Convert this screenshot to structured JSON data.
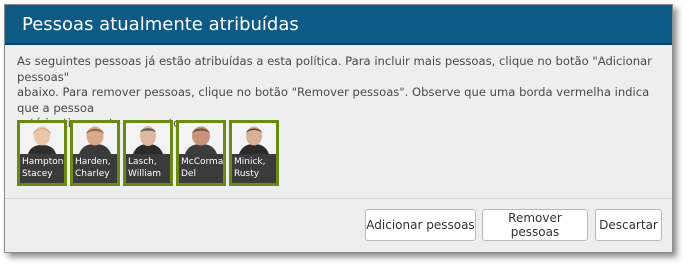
{
  "dialog": {
    "title": "Pessoas atualmente atribuídas",
    "instructions": "As seguintes pessoas já estão atribuídas a esta política. Para incluir mais pessoas, clique no botão \"Adicionar pessoas\"\nabaixo. Para remover pessoas, clique no botão \"Remover pessoas\".  Observe que uma borda vermelha indica que a pessoa\nestá inativa neste momento.",
    "people": [
      {
        "name": "Hampton,\nStacey"
      },
      {
        "name": "Harden,\nCharley"
      },
      {
        "name": "Lasch,\nWilliam"
      },
      {
        "name": "McCormac\nDel"
      },
      {
        "name": "Minick,\nRusty"
      }
    ],
    "buttons": {
      "add": "Adicionar pessoas",
      "remove": "Remover pessoas",
      "discard": "Descartar"
    }
  },
  "colors": {
    "titlebar": "#0e5a86",
    "active_border": "#6b8a13",
    "name_plate": "#3b3b3b"
  }
}
